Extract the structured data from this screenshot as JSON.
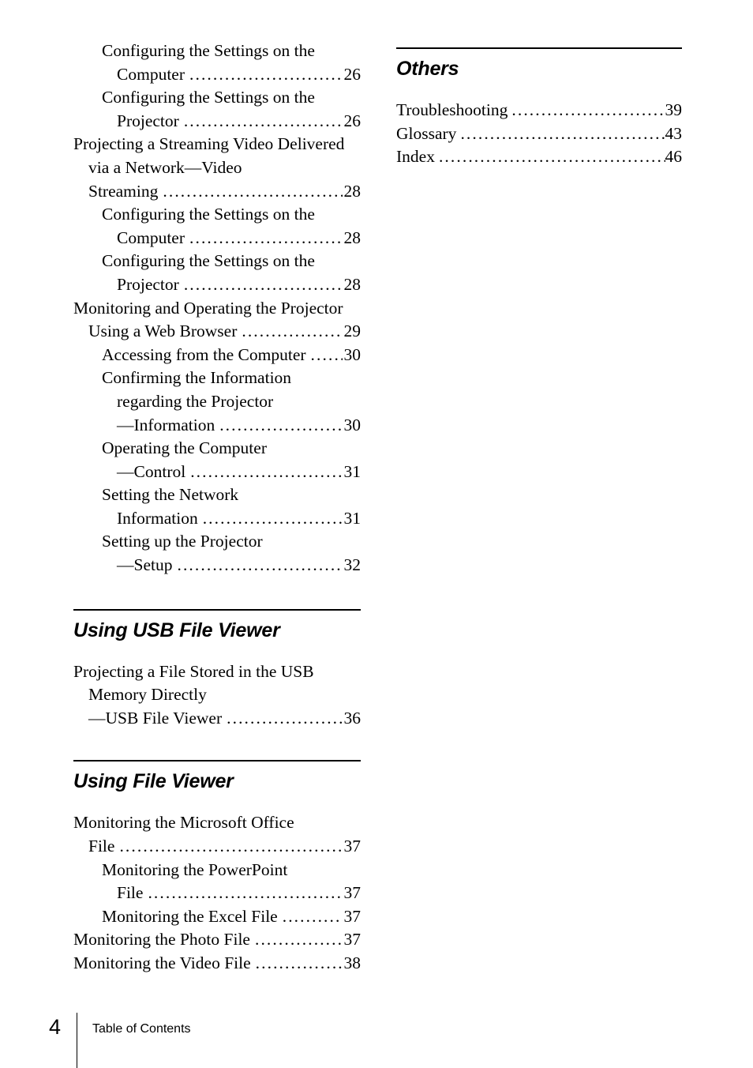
{
  "page": {
    "number": "4",
    "footer_label": "Table of Contents"
  },
  "columns": {
    "left": {
      "continued_entries": [
        {
          "level": 2,
          "lines": [
            "Configuring the Settings on the"
          ],
          "last_line": "Computer",
          "page": "26"
        },
        {
          "level": 2,
          "lines": [
            "Configuring the Settings on the"
          ],
          "last_line": "Projector",
          "page": "26"
        },
        {
          "level": 1,
          "lines": [
            "Projecting a Streaming Video Delivered",
            "via a Network—Video"
          ],
          "last_line": "Streaming",
          "page": "28"
        },
        {
          "level": 2,
          "lines": [
            "Configuring the Settings on the"
          ],
          "last_line": "Computer",
          "page": "28"
        },
        {
          "level": 2,
          "lines": [
            "Configuring the Settings on the"
          ],
          "last_line": "Projector",
          "page": "28"
        },
        {
          "level": 1,
          "lines": [
            "Monitoring and Operating the Projector"
          ],
          "last_line": "Using a Web Browser",
          "page": "29"
        },
        {
          "level": 2,
          "lines": [],
          "last_line": "Accessing from the Computer",
          "page": "30"
        },
        {
          "level": 2,
          "lines": [
            "Confirming the Information",
            "regarding the Projector"
          ],
          "last_line": "—Information",
          "page": "30"
        },
        {
          "level": 2,
          "lines": [
            "Operating the Computer"
          ],
          "last_line": "—Control",
          "page": "31"
        },
        {
          "level": 2,
          "lines": [
            "Setting the Network"
          ],
          "last_line": "Information",
          "page": "31"
        },
        {
          "level": 2,
          "lines": [
            "Setting up the Projector"
          ],
          "last_line": "—Setup",
          "page": "32"
        }
      ],
      "sections": [
        {
          "title": "Using USB File Viewer",
          "entries": [
            {
              "level": 1,
              "lines": [
                "Projecting a File Stored in the USB",
                "Memory Directly"
              ],
              "last_line": "—USB File Viewer",
              "page": "36"
            }
          ]
        },
        {
          "title": "Using File Viewer",
          "entries": [
            {
              "level": 1,
              "lines": [
                "Monitoring the Microsoft Office"
              ],
              "last_line": "File",
              "page": "37"
            },
            {
              "level": 2,
              "lines": [
                "Monitoring the PowerPoint"
              ],
              "last_line": "File",
              "page": "37"
            },
            {
              "level": 2,
              "lines": [],
              "last_line": "Monitoring the Excel File",
              "page": "37"
            },
            {
              "level": 1,
              "lines": [],
              "last_line": "Monitoring the Photo File",
              "page": "37"
            },
            {
              "level": 1,
              "lines": [],
              "last_line": "Monitoring the Video File",
              "page": "38"
            }
          ]
        }
      ]
    },
    "right": {
      "sections": [
        {
          "title": "Others",
          "entries": [
            {
              "level": 1,
              "lines": [],
              "last_line": "Troubleshooting",
              "page": "39"
            },
            {
              "level": 1,
              "lines": [],
              "last_line": "Glossary",
              "page": "43"
            },
            {
              "level": 1,
              "lines": [],
              "last_line": "Index",
              "page": "46"
            }
          ]
        }
      ]
    }
  }
}
